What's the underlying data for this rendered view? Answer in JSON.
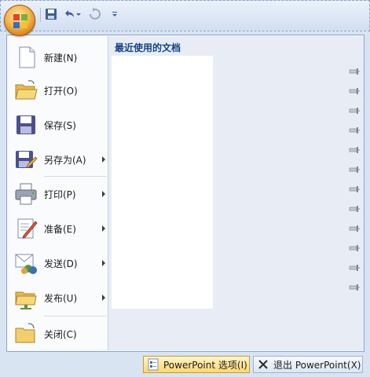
{
  "menu": {
    "items": [
      {
        "label": "新建(N)"
      },
      {
        "label": "打开(O)"
      },
      {
        "label": "保存(S)"
      },
      {
        "label": "另存为(A)"
      },
      {
        "label": "打印(P)"
      },
      {
        "label": "准备(E)"
      },
      {
        "label": "发送(D)"
      },
      {
        "label": "发布(U)"
      },
      {
        "label": "关闭(C)"
      }
    ]
  },
  "recent": {
    "title": "最近使用的文档"
  },
  "footer": {
    "options_label": "PowerPoint 选项(I)",
    "exit_label": "退出 PowerPoint(X)"
  }
}
